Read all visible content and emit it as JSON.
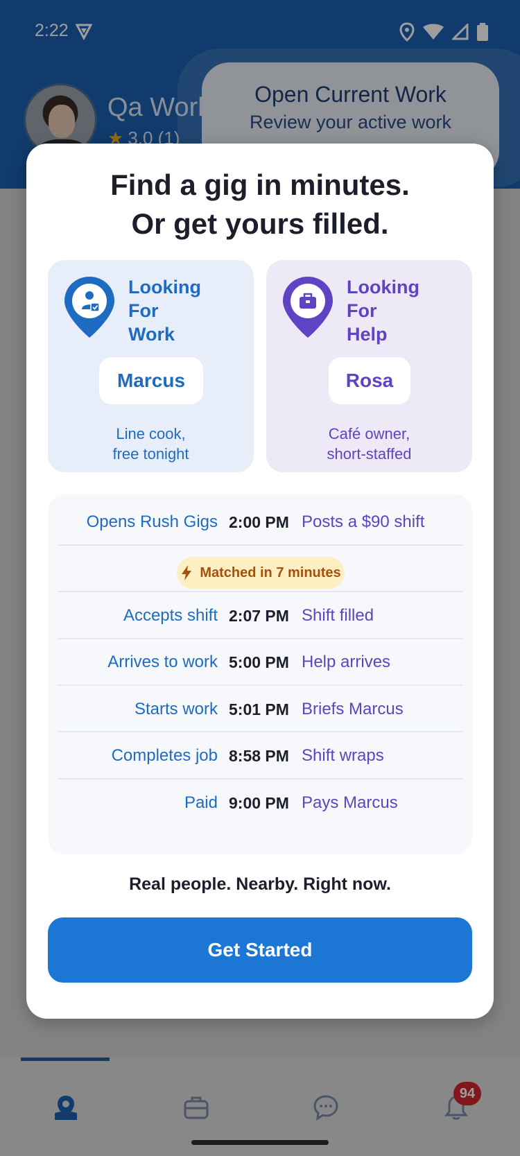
{
  "status_bar": {
    "time": "2:22"
  },
  "profile": {
    "name": "Qa Work",
    "rating": "3.0 (1)"
  },
  "open_work": {
    "title": "Open Current Work",
    "subtitle": "Review your active work"
  },
  "modal": {
    "title_line1": "Find a gig in minutes.",
    "title_line2": "Or get yours filled.",
    "work_persona": {
      "heading": [
        "Looking",
        "For",
        "Work"
      ],
      "name": "Marcus",
      "desc_line1": "Line cook,",
      "desc_line2": "free tonight",
      "icon": "worker-pin-icon"
    },
    "help_persona": {
      "heading": [
        "Looking",
        "For",
        "Help"
      ],
      "name": "Rosa",
      "desc_line1": "Café owner,",
      "desc_line2": "short-staffed",
      "icon": "briefcase-pin-icon"
    },
    "timeline": [
      {
        "left": "Opens Rush Gigs",
        "time": "2:00 PM",
        "right": "Posts a $90 shift"
      },
      {
        "left": "Accepts shift",
        "time": "2:07 PM",
        "right": "Shift filled"
      },
      {
        "left": "Arrives to work",
        "time": "5:00 PM",
        "right": "Help arrives"
      },
      {
        "left": "Starts work",
        "time": "5:01 PM",
        "right": "Briefs Marcus"
      },
      {
        "left": "Completes job",
        "time": "8:58 PM",
        "right": "Shift wraps"
      },
      {
        "left": "Paid",
        "time": "9:00 PM",
        "right": "Pays Marcus"
      }
    ],
    "match_badge": "Matched in 7 minutes",
    "tagline": "Real people. Nearby. Right now.",
    "cta": "Get Started"
  },
  "bottom_nav": {
    "items": [
      "map-icon",
      "briefcase-icon",
      "chat-icon",
      "bell-icon"
    ],
    "notification_count": "94"
  },
  "colors": {
    "primary": "#1c76d4",
    "work_accent": "#1e6bc2",
    "help_accent": "#5e44c3",
    "header_blue": "#1a5fae",
    "match_bg": "#fdefc2",
    "match_text": "#a3510d"
  }
}
